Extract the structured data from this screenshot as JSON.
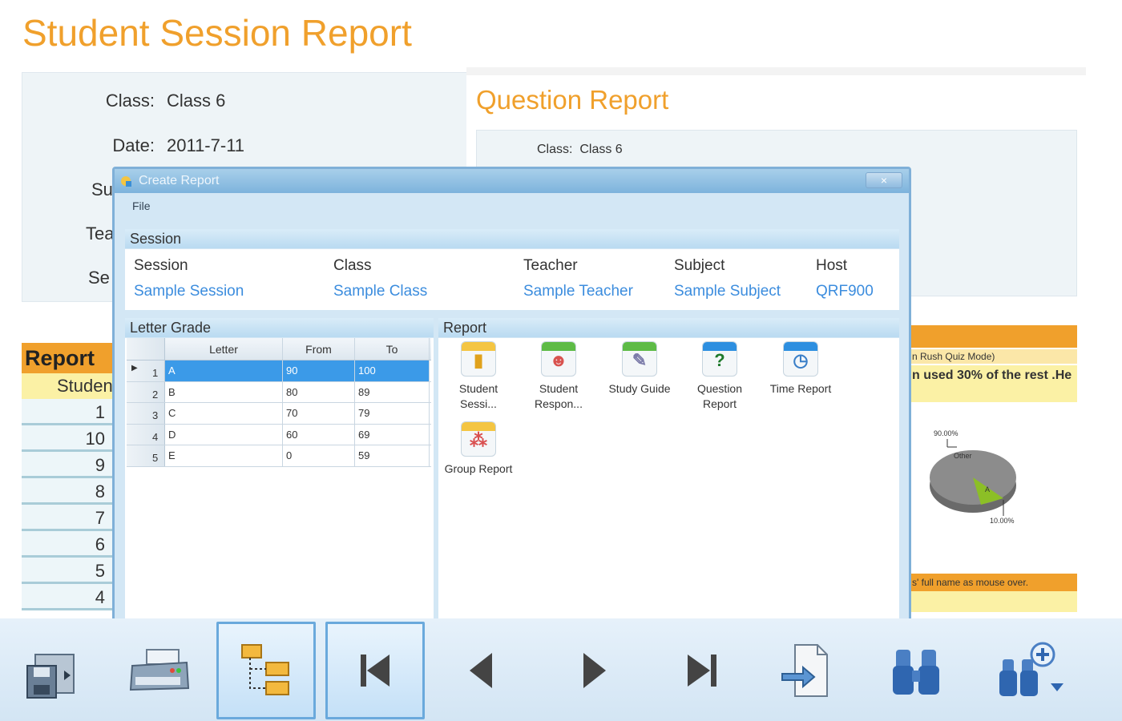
{
  "background": {
    "title": "Student Session Report",
    "info": [
      {
        "label": "Class:",
        "value": "Class 6"
      },
      {
        "label": "Date:",
        "value": "2011-7-11"
      },
      {
        "label": "Su",
        "value": ""
      },
      {
        "label": "Tea",
        "value": ""
      },
      {
        "label": "Se",
        "value": ""
      }
    ],
    "report_header": "Report",
    "report_subheader": "Studen",
    "report_rows": [
      "1",
      "10",
      "9",
      "8",
      "7",
      "6",
      "5",
      "4"
    ],
    "question_report": {
      "title": "Question Report",
      "class_label": "Class:",
      "class_value": "Class 6"
    },
    "right_texts": {
      "mode": "n Rush Quiz Mode)",
      "used": "n used 30% of the rest .He",
      "pct_top": "90.00%",
      "other": "Other",
      "a": "A",
      "pct_bottom": "10.00%",
      "footer": "s' full name as mouse over."
    }
  },
  "dialog": {
    "title": "Create Report",
    "close": "×",
    "menu": [
      "File"
    ],
    "session_section": "Session",
    "session_fields": [
      {
        "label": "Session",
        "value": "Sample Session"
      },
      {
        "label": "Class",
        "value": "Sample Class"
      },
      {
        "label": "Teacher",
        "value": "Sample Teacher"
      },
      {
        "label": "Subject",
        "value": "Sample Subject"
      },
      {
        "label": "Host",
        "value": "QRF900"
      }
    ],
    "letter_grade_section": "Letter Grade",
    "grade_columns": [
      "Letter",
      "From",
      "To"
    ],
    "grade_rows": [
      {
        "n": "1",
        "letter": "A",
        "from": "90",
        "to": "100"
      },
      {
        "n": "2",
        "letter": "B",
        "from": "80",
        "to": "89"
      },
      {
        "n": "3",
        "letter": "C",
        "from": "70",
        "to": "79"
      },
      {
        "n": "4",
        "letter": "D",
        "from": "60",
        "to": "69"
      },
      {
        "n": "5",
        "letter": "E",
        "from": "0",
        "to": "59"
      }
    ],
    "report_section": "Report",
    "reports": [
      {
        "line1": "Student",
        "line2": "Sessi...",
        "icon": "student-session-icon",
        "color": "#f4c542"
      },
      {
        "line1": "Student",
        "line2": "Respon...",
        "icon": "student-response-icon",
        "color": "#5dbb46"
      },
      {
        "line1": "Study Guide",
        "line2": "",
        "icon": "study-guide-icon",
        "color": "#5dbb46"
      },
      {
        "line1": "Question",
        "line2": "Report",
        "icon": "question-report-icon",
        "color": "#2d8fe0"
      },
      {
        "line1": "Time Report",
        "line2": "",
        "icon": "time-report-icon",
        "color": "#2d8fe0"
      },
      {
        "line1": "Group Report",
        "line2": "",
        "icon": "group-report-icon",
        "color": "#f4c542"
      }
    ]
  },
  "toolbar": [
    {
      "icon": "save-icon",
      "active": false
    },
    {
      "icon": "print-icon",
      "active": false
    },
    {
      "icon": "tree-view-icon",
      "active": true
    },
    {
      "icon": "first-page-icon",
      "active": true
    },
    {
      "icon": "previous-page-icon",
      "active": false
    },
    {
      "icon": "next-page-icon",
      "active": false
    },
    {
      "icon": "last-page-icon",
      "active": false
    },
    {
      "icon": "export-icon",
      "active": false
    },
    {
      "icon": "find-icon",
      "active": false
    },
    {
      "icon": "find-more-icon",
      "active": false
    }
  ],
  "colors": {
    "accent": "#f0a02c",
    "link": "#3c8dde",
    "selection": "#3b9ae8"
  }
}
